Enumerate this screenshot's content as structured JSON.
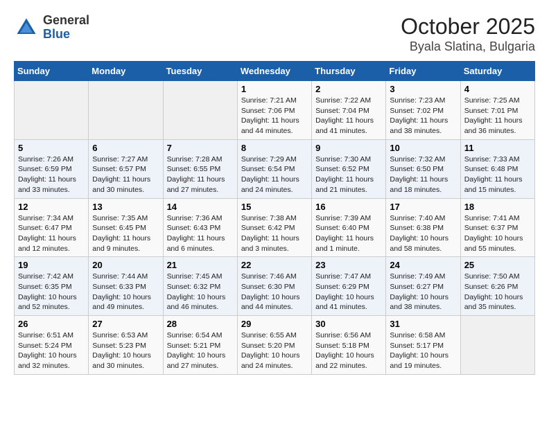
{
  "header": {
    "logo_general": "General",
    "logo_blue": "Blue",
    "title": "October 2025",
    "subtitle": "Byala Slatina, Bulgaria"
  },
  "days_of_week": [
    "Sunday",
    "Monday",
    "Tuesday",
    "Wednesday",
    "Thursday",
    "Friday",
    "Saturday"
  ],
  "weeks": [
    [
      {
        "day": "",
        "info": ""
      },
      {
        "day": "",
        "info": ""
      },
      {
        "day": "",
        "info": ""
      },
      {
        "day": "1",
        "info": "Sunrise: 7:21 AM\nSunset: 7:06 PM\nDaylight: 11 hours and 44 minutes."
      },
      {
        "day": "2",
        "info": "Sunrise: 7:22 AM\nSunset: 7:04 PM\nDaylight: 11 hours and 41 minutes."
      },
      {
        "day": "3",
        "info": "Sunrise: 7:23 AM\nSunset: 7:02 PM\nDaylight: 11 hours and 38 minutes."
      },
      {
        "day": "4",
        "info": "Sunrise: 7:25 AM\nSunset: 7:01 PM\nDaylight: 11 hours and 36 minutes."
      }
    ],
    [
      {
        "day": "5",
        "info": "Sunrise: 7:26 AM\nSunset: 6:59 PM\nDaylight: 11 hours and 33 minutes."
      },
      {
        "day": "6",
        "info": "Sunrise: 7:27 AM\nSunset: 6:57 PM\nDaylight: 11 hours and 30 minutes."
      },
      {
        "day": "7",
        "info": "Sunrise: 7:28 AM\nSunset: 6:55 PM\nDaylight: 11 hours and 27 minutes."
      },
      {
        "day": "8",
        "info": "Sunrise: 7:29 AM\nSunset: 6:54 PM\nDaylight: 11 hours and 24 minutes."
      },
      {
        "day": "9",
        "info": "Sunrise: 7:30 AM\nSunset: 6:52 PM\nDaylight: 11 hours and 21 minutes."
      },
      {
        "day": "10",
        "info": "Sunrise: 7:32 AM\nSunset: 6:50 PM\nDaylight: 11 hours and 18 minutes."
      },
      {
        "day": "11",
        "info": "Sunrise: 7:33 AM\nSunset: 6:48 PM\nDaylight: 11 hours and 15 minutes."
      }
    ],
    [
      {
        "day": "12",
        "info": "Sunrise: 7:34 AM\nSunset: 6:47 PM\nDaylight: 11 hours and 12 minutes."
      },
      {
        "day": "13",
        "info": "Sunrise: 7:35 AM\nSunset: 6:45 PM\nDaylight: 11 hours and 9 minutes."
      },
      {
        "day": "14",
        "info": "Sunrise: 7:36 AM\nSunset: 6:43 PM\nDaylight: 11 hours and 6 minutes."
      },
      {
        "day": "15",
        "info": "Sunrise: 7:38 AM\nSunset: 6:42 PM\nDaylight: 11 hours and 3 minutes."
      },
      {
        "day": "16",
        "info": "Sunrise: 7:39 AM\nSunset: 6:40 PM\nDaylight: 11 hours and 1 minute."
      },
      {
        "day": "17",
        "info": "Sunrise: 7:40 AM\nSunset: 6:38 PM\nDaylight: 10 hours and 58 minutes."
      },
      {
        "day": "18",
        "info": "Sunrise: 7:41 AM\nSunset: 6:37 PM\nDaylight: 10 hours and 55 minutes."
      }
    ],
    [
      {
        "day": "19",
        "info": "Sunrise: 7:42 AM\nSunset: 6:35 PM\nDaylight: 10 hours and 52 minutes."
      },
      {
        "day": "20",
        "info": "Sunrise: 7:44 AM\nSunset: 6:33 PM\nDaylight: 10 hours and 49 minutes."
      },
      {
        "day": "21",
        "info": "Sunrise: 7:45 AM\nSunset: 6:32 PM\nDaylight: 10 hours and 46 minutes."
      },
      {
        "day": "22",
        "info": "Sunrise: 7:46 AM\nSunset: 6:30 PM\nDaylight: 10 hours and 44 minutes."
      },
      {
        "day": "23",
        "info": "Sunrise: 7:47 AM\nSunset: 6:29 PM\nDaylight: 10 hours and 41 minutes."
      },
      {
        "day": "24",
        "info": "Sunrise: 7:49 AM\nSunset: 6:27 PM\nDaylight: 10 hours and 38 minutes."
      },
      {
        "day": "25",
        "info": "Sunrise: 7:50 AM\nSunset: 6:26 PM\nDaylight: 10 hours and 35 minutes."
      }
    ],
    [
      {
        "day": "26",
        "info": "Sunrise: 6:51 AM\nSunset: 5:24 PM\nDaylight: 10 hours and 32 minutes."
      },
      {
        "day": "27",
        "info": "Sunrise: 6:53 AM\nSunset: 5:23 PM\nDaylight: 10 hours and 30 minutes."
      },
      {
        "day": "28",
        "info": "Sunrise: 6:54 AM\nSunset: 5:21 PM\nDaylight: 10 hours and 27 minutes."
      },
      {
        "day": "29",
        "info": "Sunrise: 6:55 AM\nSunset: 5:20 PM\nDaylight: 10 hours and 24 minutes."
      },
      {
        "day": "30",
        "info": "Sunrise: 6:56 AM\nSunset: 5:18 PM\nDaylight: 10 hours and 22 minutes."
      },
      {
        "day": "31",
        "info": "Sunrise: 6:58 AM\nSunset: 5:17 PM\nDaylight: 10 hours and 19 minutes."
      },
      {
        "day": "",
        "info": ""
      }
    ]
  ]
}
